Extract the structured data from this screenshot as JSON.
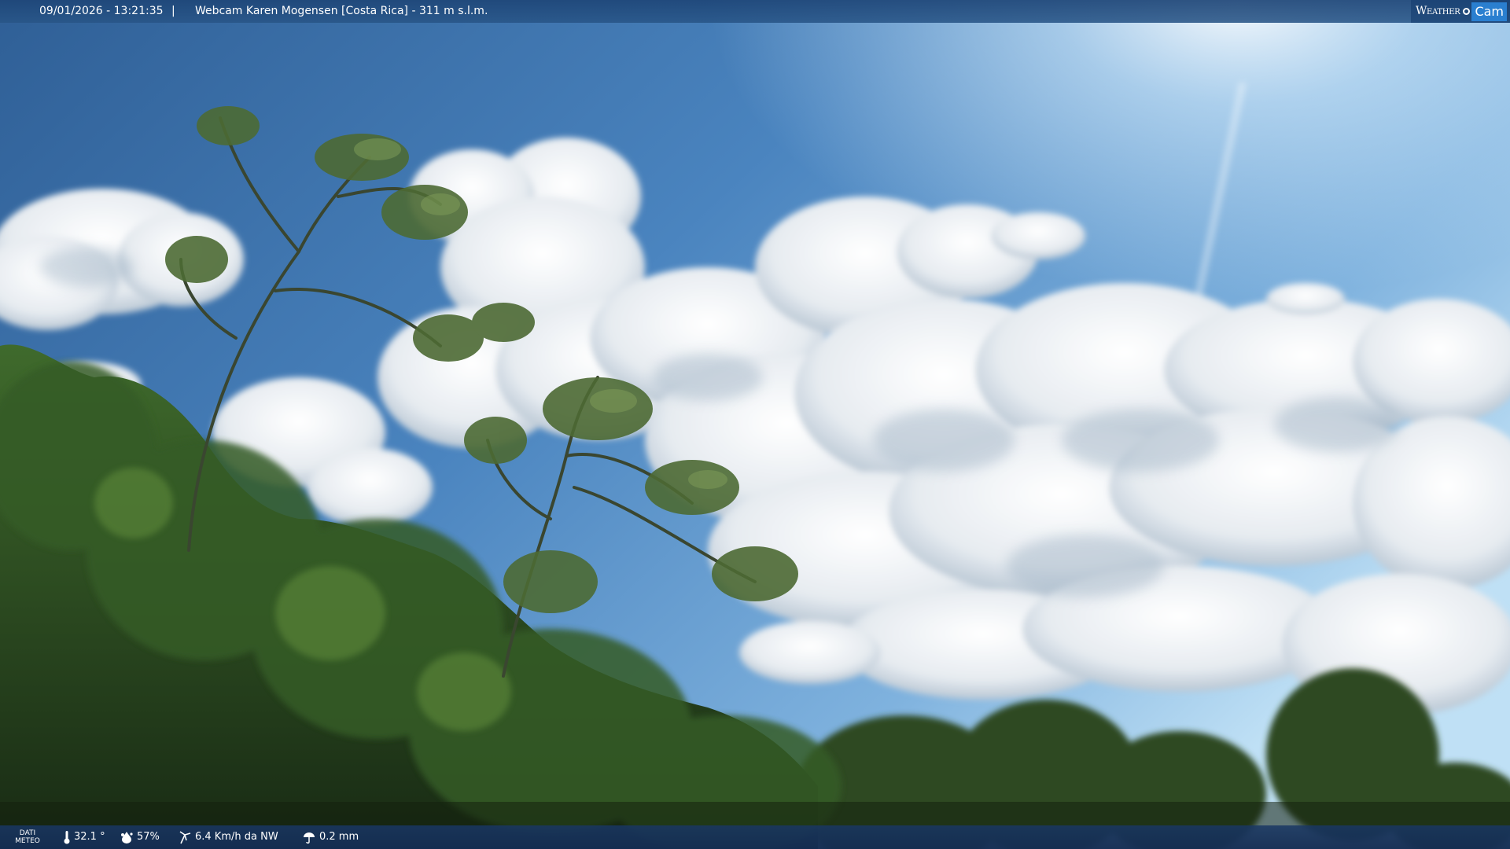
{
  "header": {
    "datetime": "09/01/2026 - 13:21:35",
    "separator": "|",
    "title": "Webcam Karen Mogensen [Costa Rica] - 311 m s.l.m.",
    "logo": {
      "weather_text": "Weather",
      "cam_text": "Cam",
      "accent_color": "#2a7fd0"
    }
  },
  "weather_bar": {
    "label_line1": "DATI",
    "label_line2": "METEO",
    "temperature": "32.1 °",
    "humidity": "57%",
    "wind": "6.4 Km/h da NW",
    "rain": "0.2 mm",
    "icons": [
      "thermometer-icon",
      "humidity-icon",
      "wind-icon",
      "rain-icon"
    ]
  },
  "scene": {
    "subject": "sky-with-clouds-and-trees",
    "sky_color": "#3f78b5",
    "cloud_color": "#f2f5f8",
    "foliage_color": "#2f4a22"
  }
}
